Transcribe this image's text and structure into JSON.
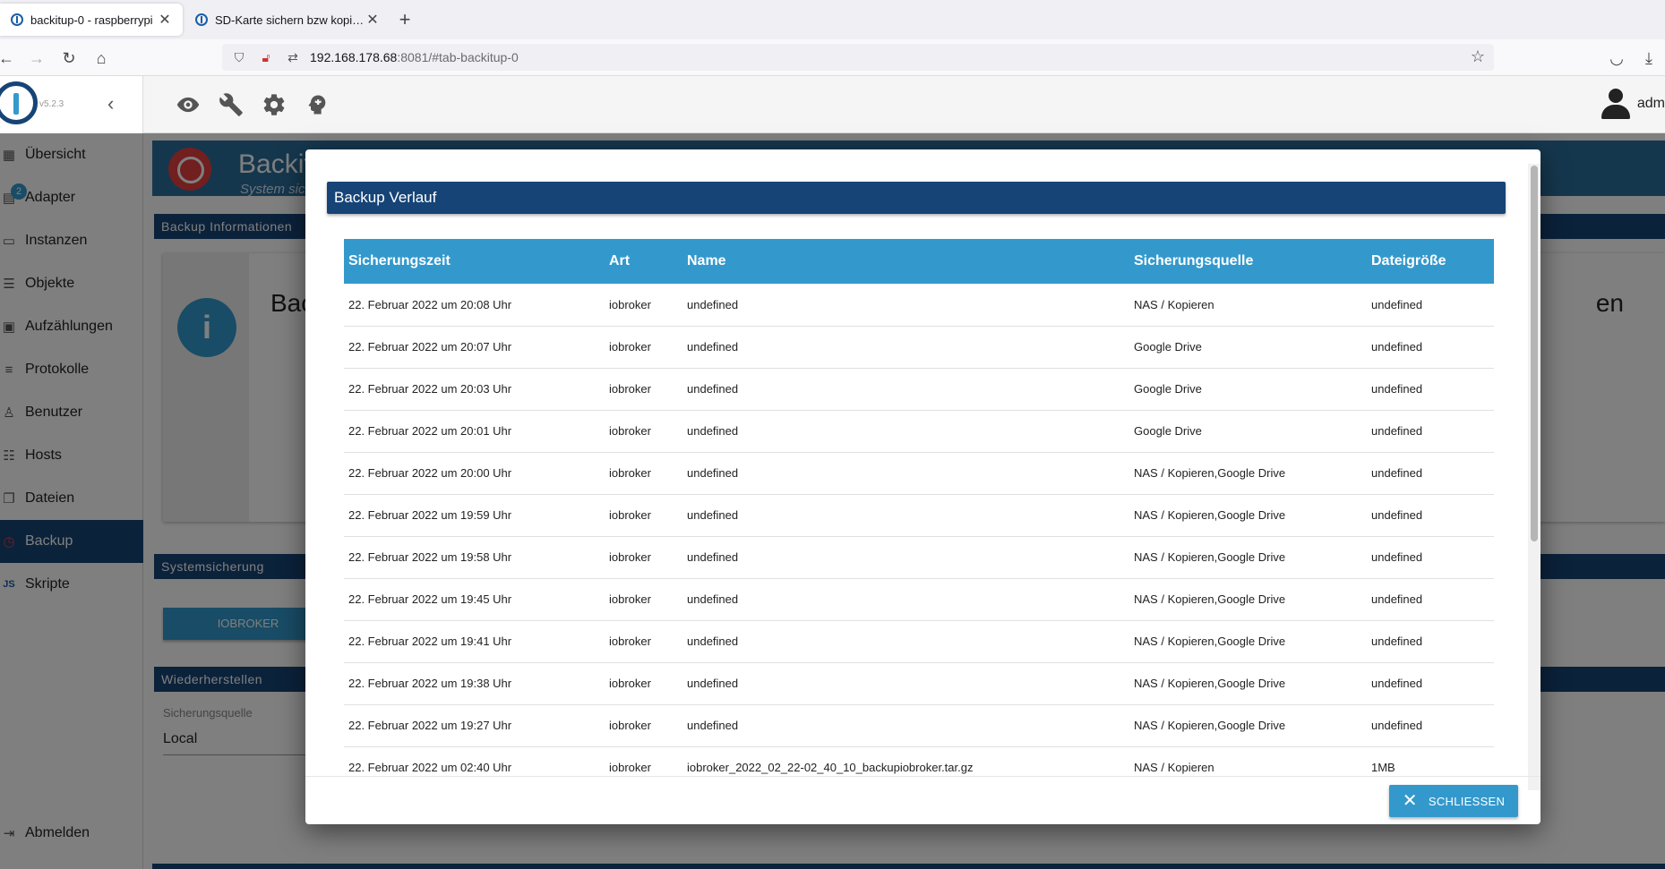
{
  "browser": {
    "tabs": [
      {
        "title": "backitup-0 - raspberrypi",
        "active": true
      },
      {
        "title": "SD-Karte sichern bzw kopieren",
        "active": false
      }
    ],
    "url_host": "192.168.178.68",
    "url_path": ":8081/#tab-backitup-0"
  },
  "app": {
    "version": "v5.2.3",
    "user": "adm"
  },
  "sidebar": {
    "items": [
      {
        "label": "Übersicht",
        "icon": "grid-icon"
      },
      {
        "label": "Adapter",
        "icon": "store-icon",
        "badge": "2"
      },
      {
        "label": "Instanzen",
        "icon": "instances-icon"
      },
      {
        "label": "Objekte",
        "icon": "list-icon"
      },
      {
        "label": "Aufzählungen",
        "icon": "enum-icon"
      },
      {
        "label": "Protokolle",
        "icon": "log-icon"
      },
      {
        "label": "Benutzer",
        "icon": "user-icon"
      },
      {
        "label": "Hosts",
        "icon": "hosts-icon"
      },
      {
        "label": "Dateien",
        "icon": "files-icon"
      },
      {
        "label": "Backup",
        "icon": "backup-icon",
        "active": true
      },
      {
        "label": "Skripte",
        "icon": "js-icon"
      }
    ],
    "logout": "Abmelden"
  },
  "background": {
    "banner_title": "Backit",
    "banner_subtitle": "System sich",
    "section_info": "Backup Informationen",
    "card_title_left": "Bac",
    "card_title_right": "en",
    "section_system": "Systemsicherung",
    "button": "IOBROKER",
    "section_restore": "Wiederherstellen",
    "source_label": "Sicherungsquelle",
    "source_value": "Local"
  },
  "dialog": {
    "title": "Backup Verlauf",
    "columns": [
      "Sicherungszeit",
      "Art",
      "Name",
      "Sicherungsquelle",
      "Dateigröße"
    ],
    "rows": [
      [
        "22. Februar 2022 um 20:08 Uhr",
        "iobroker",
        "undefined",
        "NAS / Kopieren",
        "undefined"
      ],
      [
        "22. Februar 2022 um 20:07 Uhr",
        "iobroker",
        "undefined",
        "Google Drive",
        "undefined"
      ],
      [
        "22. Februar 2022 um 20:03 Uhr",
        "iobroker",
        "undefined",
        "Google Drive",
        "undefined"
      ],
      [
        "22. Februar 2022 um 20:01 Uhr",
        "iobroker",
        "undefined",
        "Google Drive",
        "undefined"
      ],
      [
        "22. Februar 2022 um 20:00 Uhr",
        "iobroker",
        "undefined",
        "NAS / Kopieren,Google Drive",
        "undefined"
      ],
      [
        "22. Februar 2022 um 19:59 Uhr",
        "iobroker",
        "undefined",
        "NAS / Kopieren,Google Drive",
        "undefined"
      ],
      [
        "22. Februar 2022 um 19:58 Uhr",
        "iobroker",
        "undefined",
        "NAS / Kopieren,Google Drive",
        "undefined"
      ],
      [
        "22. Februar 2022 um 19:45 Uhr",
        "iobroker",
        "undefined",
        "NAS / Kopieren,Google Drive",
        "undefined"
      ],
      [
        "22. Februar 2022 um 19:41 Uhr",
        "iobroker",
        "undefined",
        "NAS / Kopieren,Google Drive",
        "undefined"
      ],
      [
        "22. Februar 2022 um 19:38 Uhr",
        "iobroker",
        "undefined",
        "NAS / Kopieren,Google Drive",
        "undefined"
      ],
      [
        "22. Februar 2022 um 19:27 Uhr",
        "iobroker",
        "undefined",
        "NAS / Kopieren,Google Drive",
        "undefined"
      ],
      [
        "22. Februar 2022 um 02:40 Uhr",
        "iobroker",
        "iobroker_2022_02_22-02_40_10_backupiobroker.tar.gz",
        "NAS / Kopieren",
        "1MB"
      ]
    ],
    "close_label": "SCHLIESSEN"
  },
  "colors": {
    "primary_dark": "#164477",
    "primary_light": "#3399cc",
    "banner": "#2b6e9c",
    "accent_red": "#e43f3f"
  }
}
